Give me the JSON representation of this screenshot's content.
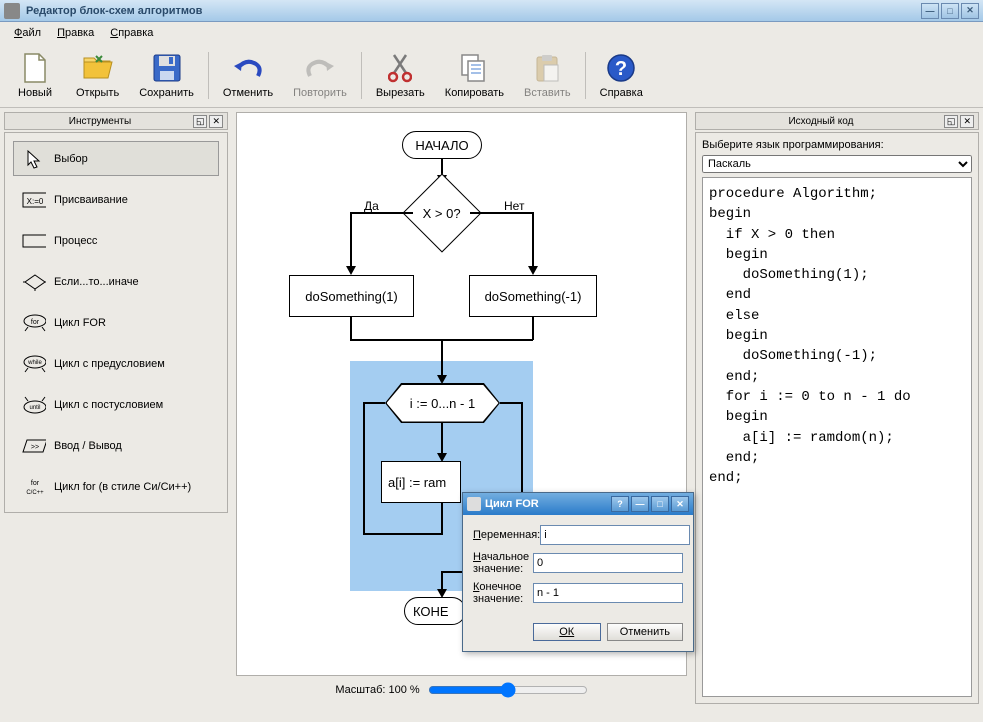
{
  "window": {
    "title": "Редактор блок-схем алгоритмов"
  },
  "menu": {
    "file": "Файл",
    "edit": "Правка",
    "help": "Справка"
  },
  "toolbar": {
    "new": "Новый",
    "open": "Открыть",
    "save": "Сохранить",
    "undo": "Отменить",
    "redo": "Повторить",
    "cut": "Вырезать",
    "copy": "Копировать",
    "paste": "Вставить",
    "help": "Справка"
  },
  "panels": {
    "tools_title": "Инструменты",
    "source_title": "Исходный код",
    "lang_label": "Выберите язык программирования:",
    "lang_selected": "Паскаль"
  },
  "tools": {
    "select": "Выбор",
    "assign": "Присваивание",
    "process": "Процесс",
    "ifelse": "Если...то...иначе",
    "for": "Цикл FOR",
    "while": "Цикл с предусловием",
    "until": "Цикл с постусловием",
    "io": "Ввод / Вывод",
    "cfor": "Цикл for (в стиле Си/Си++)"
  },
  "flowchart": {
    "begin": "НАЧАЛО",
    "cond": "X > 0?",
    "yes": "Да",
    "no": "Нет",
    "do1": "doSomething(1)",
    "do2": "doSomething(-1)",
    "loop": "i := 0...n - 1",
    "body": "a[i] := ram",
    "end": "КОНЕ"
  },
  "source_code": "procedure Algorithm;\nbegin\n  if X > 0 then\n  begin\n    doSomething(1);\n  end\n  else\n  begin\n    doSomething(-1);\n  end;\n  for i := 0 to n - 1 do\n  begin\n    a[i] := ramdom(n);\n  end;\nend;",
  "zoom": {
    "label": "Масштаб: 100 %"
  },
  "dialog": {
    "title": "Цикл FOR",
    "var_label": "Переменная:",
    "start_label": "Начальное значение:",
    "end_label": "Конечное значение:",
    "var_value": "i",
    "start_value": "0",
    "end_value": "n - 1",
    "ok": "ОК",
    "cancel": "Отменить"
  }
}
